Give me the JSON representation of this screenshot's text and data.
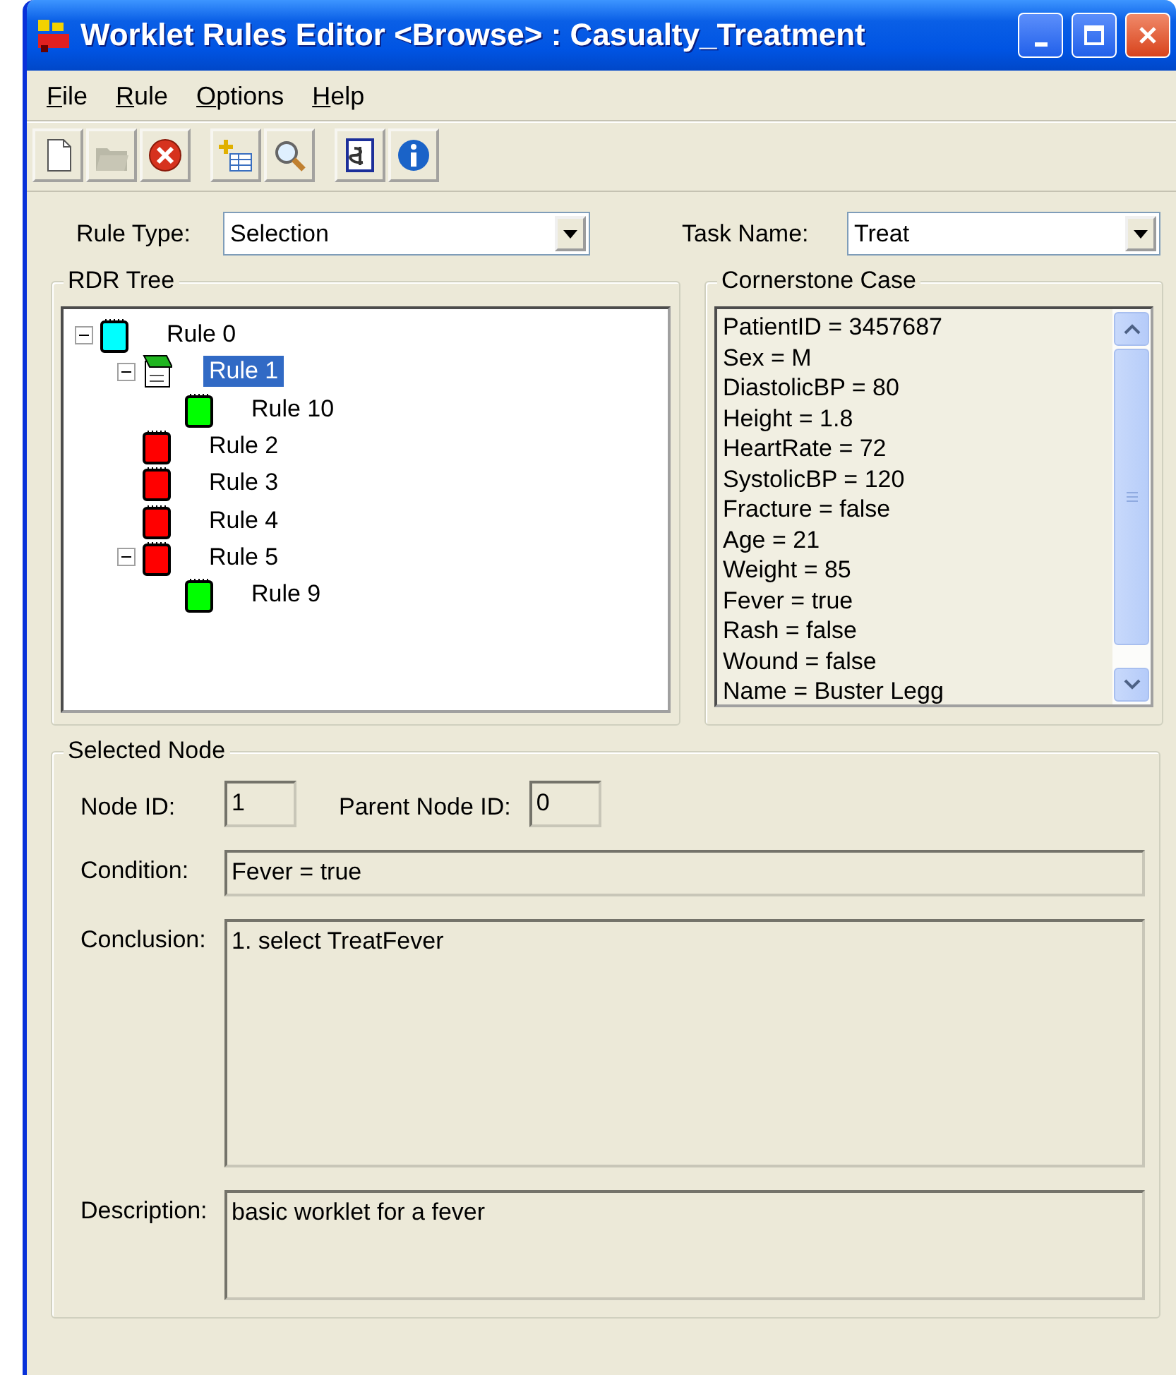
{
  "window": {
    "title": "Worklet Rules Editor <Browse> : Casualty_Treatment"
  },
  "menu": [
    "File",
    "Rule",
    "Options",
    "Help"
  ],
  "toolbar": [
    [
      {
        "kind": "new",
        "disabled": false
      },
      {
        "kind": "open",
        "disabled": true
      },
      {
        "kind": "close",
        "disabled": false
      }
    ],
    [
      {
        "kind": "add",
        "disabled": false
      },
      {
        "kind": "find",
        "disabled": false
      }
    ],
    [
      {
        "kind": "script",
        "disabled": false
      },
      {
        "kind": "info",
        "disabled": false
      }
    ]
  ],
  "rule_type": {
    "label": "Rule Type:",
    "value": "Selection"
  },
  "task_name": {
    "label": "Task Name:",
    "value": "Treat"
  },
  "rdr_tree": {
    "title": "RDR Tree",
    "nodes": [
      {
        "label": "Rule 0",
        "kind": "root",
        "selected": false,
        "expanded": true,
        "children": [
          {
            "label": "Rule 1",
            "kind": "document",
            "selected": true,
            "expanded": true,
            "children": [
              {
                "label": "Rule 10",
                "kind": "true",
                "selected": false
              }
            ]
          },
          {
            "label": "Rule 2",
            "kind": "false",
            "selected": false
          },
          {
            "label": "Rule 3",
            "kind": "false",
            "selected": false
          },
          {
            "label": "Rule 4",
            "kind": "false",
            "selected": false
          },
          {
            "label": "Rule 5",
            "kind": "false",
            "selected": false,
            "expanded": true,
            "children": [
              {
                "label": "Rule 9",
                "kind": "true",
                "selected": false
              }
            ]
          }
        ]
      }
    ]
  },
  "cornerstone_case": {
    "title": "Cornerstone Case",
    "items": [
      "PatientID = 3457687",
      "Sex = M",
      "DiastolicBP = 80",
      "Height = 1.8",
      "HeartRate = 72",
      "SystolicBP = 120",
      "Fracture = false",
      "Age = 21",
      "Weight = 85",
      "Fever = true",
      "Rash = false",
      "Wound = false",
      "Name = Buster Legg"
    ]
  },
  "selected_node": {
    "title": "Selected Node",
    "node_id": {
      "label": "Node ID:",
      "value": "1"
    },
    "parent_node_id": {
      "label": "Parent Node ID:",
      "value": "0"
    },
    "condition": {
      "label": "Condition:",
      "value": "Fever = true"
    },
    "conclusion": {
      "label": "Conclusion:",
      "value": "1. select TreatFever"
    },
    "description": {
      "label": "Description:",
      "value": "basic worklet for a fever"
    }
  }
}
